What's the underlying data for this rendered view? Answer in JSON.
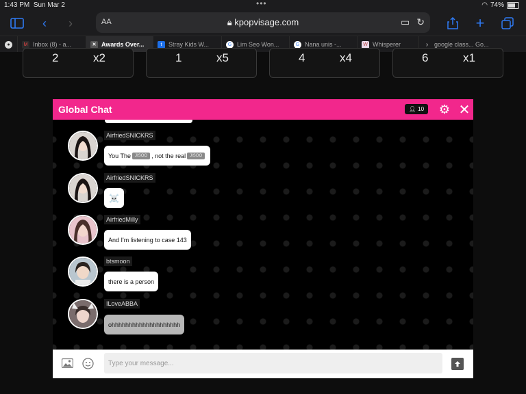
{
  "status_bar": {
    "time": "1:43 PM",
    "date": "Sun Mar 2",
    "battery": "74%"
  },
  "browser": {
    "url": "kpopvisage.com",
    "reader_label": "AA",
    "tabs": [
      {
        "label": "Inbox (8) - a...",
        "fav_color": "#2b2b2b",
        "fav_text": "M",
        "active": false
      },
      {
        "label": "Awards Over...",
        "fav_color": "#555555",
        "fav_text": "✕",
        "active": true
      },
      {
        "label": "Stray Kids W...",
        "fav_color": "#1d6fe8",
        "fav_text": "t",
        "active": false
      },
      {
        "label": "Lim Seo Won...",
        "fav_color": "#ffffff",
        "fav_text": "G",
        "active": false
      },
      {
        "label": "Nana unis -...",
        "fav_color": "#ffffff",
        "fav_text": "G",
        "active": false
      },
      {
        "label": "Whisperer",
        "fav_color": "#e9d9e9",
        "fav_text": "W",
        "active": false
      },
      {
        "label": "google class... Go...",
        "fav_color": "#1c1c1e",
        "fav_text": "›",
        "active": false
      }
    ]
  },
  "stat_cards": [
    {
      "value": "2",
      "multiplier": "x2"
    },
    {
      "value": "1",
      "multiplier": "x5"
    },
    {
      "value": "4",
      "multiplier": "x4"
    },
    {
      "value": "6",
      "multiplier": "x1"
    }
  ],
  "chat": {
    "title": "Global Chat",
    "user_count": "10",
    "accent": "#f2278c",
    "messages": [
      {
        "username": "AirfriedSNICKRS",
        "text_before": "You The",
        "tag1": "JISOO",
        "text_middle": ", not the real",
        "tag2": "JISOO"
      },
      {
        "username": "AirfriedSNICKRS",
        "text": "☠️"
      },
      {
        "username": "AirfriedMilly",
        "text": "And I'm listening to case 143"
      },
      {
        "username": "btsmoon",
        "text": "there is a person"
      },
      {
        "username": "ILoveABBA",
        "text": "ohhhhhhhhhhhhhhhhhhhh"
      }
    ],
    "input_placeholder": "Type your message..."
  }
}
